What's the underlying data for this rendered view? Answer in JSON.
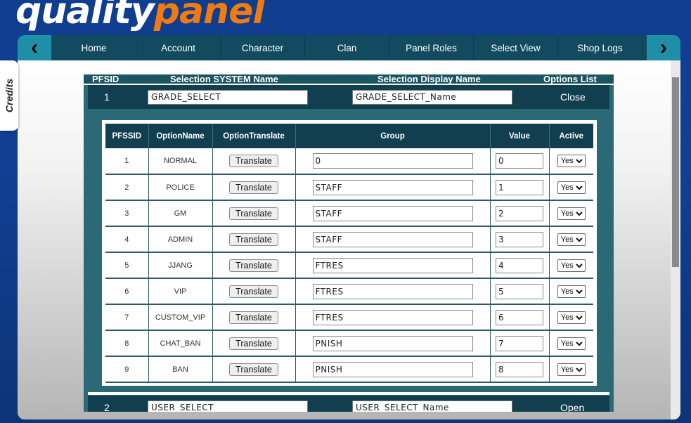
{
  "logo": {
    "part1": "quality",
    "part2": "panel"
  },
  "nav": {
    "prev_icon": "chevron-left-icon",
    "next_icon": "chevron-right-icon",
    "items": [
      {
        "label": "Home",
        "dropdown": true
      },
      {
        "label": "Account",
        "dropdown": true
      },
      {
        "label": "Character",
        "dropdown": true
      },
      {
        "label": "Clan",
        "dropdown": true
      },
      {
        "label": "Panel Roles",
        "dropdown": false
      },
      {
        "label": "Select View",
        "dropdown": false
      },
      {
        "label": "Shop Logs",
        "dropdown": false
      }
    ]
  },
  "credits_tab": {
    "label": "Credits"
  },
  "headers": {
    "pfsid": "PFSID",
    "system_name": "Selection SYSTEM Name",
    "display_name": "Selection Display Name",
    "options": "Options List"
  },
  "selections": [
    {
      "id": "1",
      "system_name": "GRADE_SELECT",
      "display_name": "GRADE_SELECT_Name",
      "action": "Close"
    },
    {
      "id": "2",
      "system_name": "USER_SELECT",
      "display_name": "USER_SELECT_Name",
      "action": "Open"
    }
  ],
  "options_table": {
    "columns": [
      "PFSSID",
      "OptionName",
      "OptionTranslate",
      "Group",
      "Value",
      "Active"
    ],
    "translate_label": "Translate",
    "rows": [
      {
        "id": "1",
        "name": "NORMAL",
        "group": "0",
        "value": "0",
        "active": "Yes"
      },
      {
        "id": "2",
        "name": "POLICE",
        "group": "STAFF",
        "value": "1",
        "active": "Yes"
      },
      {
        "id": "3",
        "name": "GM",
        "group": "STAFF",
        "value": "2",
        "active": "Yes"
      },
      {
        "id": "4",
        "name": "ADMIN",
        "group": "STAFF",
        "value": "3",
        "active": "Yes"
      },
      {
        "id": "5",
        "name": "JJANG",
        "group": "FTRES",
        "value": "4",
        "active": "Yes"
      },
      {
        "id": "6",
        "name": "VIP",
        "group": "FTRES",
        "value": "5",
        "active": "Yes"
      },
      {
        "id": "7",
        "name": "CUSTOM_VIP",
        "group": "FTRES",
        "value": "6",
        "active": "Yes"
      },
      {
        "id": "8",
        "name": "CHAT_BAN",
        "group": "PNISH",
        "value": "7",
        "active": "Yes"
      },
      {
        "id": "9",
        "name": "BAN",
        "group": "PNISH",
        "value": "8",
        "active": "Yes"
      }
    ]
  }
}
